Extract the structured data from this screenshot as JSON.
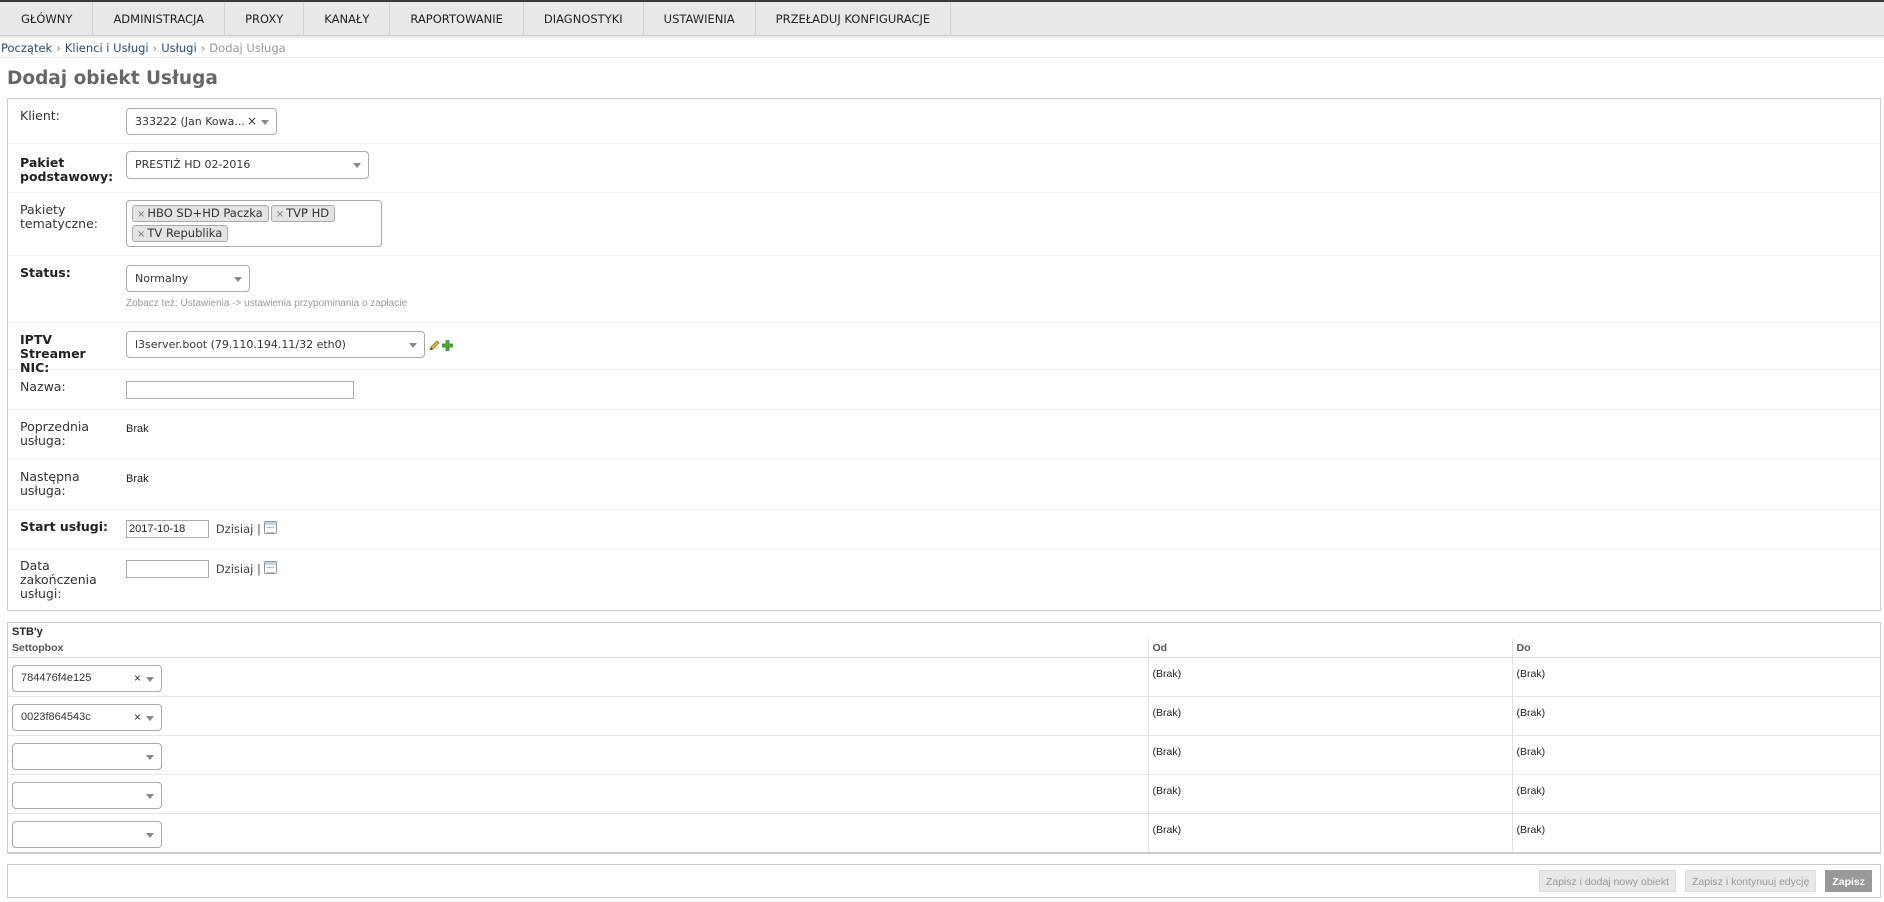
{
  "nav": [
    "GŁÓWNY",
    "ADMINISTRACJA",
    "PROXY",
    "KANAŁY",
    "RAPORTOWANIE",
    "DIAGNOSTYKI",
    "USTAWIENIA",
    "PRZEŁADUJ KONFIGURACJE"
  ],
  "breadcrumbs": {
    "home": "Początek",
    "app": "Klienci i Usługi",
    "model": "Usługi",
    "current": "Dodaj Usługa"
  },
  "page_title": "Dodaj obiekt Usługa",
  "form": {
    "klient": {
      "label": "Klient:",
      "value": "333222 (Jan Kowa..."
    },
    "pakiet": {
      "label": "Pakiet podstawowy:",
      "value": "PRESTIŻ HD 02-2016"
    },
    "tematyczne": {
      "label": "Pakiety tematyczne:",
      "tags": [
        "HBO SD+HD Paczka",
        "TVP HD",
        "TV Republika"
      ]
    },
    "status": {
      "label": "Status:",
      "value": "Normalny",
      "help": "Zobacz też: Ustawienia -> ustawienia przypominania o zapłacie"
    },
    "iptv": {
      "label": "IPTV Streamer NIC:",
      "value": "l3server.boot (79.110.194.11/32 eth0)"
    },
    "nazwa": {
      "label": "Nazwa:",
      "value": ""
    },
    "poprzednia": {
      "label": "Poprzednia usługa:",
      "value": "Brak"
    },
    "nastepna": {
      "label": "Następna usługa:",
      "value": "Brak"
    },
    "start": {
      "label": "Start usługi:",
      "value": "2017-10-18",
      "today": "Dzisiaj |"
    },
    "koniec": {
      "label": "Data zakończenia usługi:",
      "value": "",
      "today": "Dzisiaj |"
    }
  },
  "stb": {
    "title": "STB'y",
    "headers": [
      "Settopbox",
      "Od",
      "Do"
    ],
    "rows": [
      {
        "settopbox": "784476f4e125",
        "od": "(Brak)",
        "do": "(Brak)"
      },
      {
        "settopbox": "0023f864543c",
        "od": "(Brak)",
        "do": "(Brak)"
      },
      {
        "settopbox": "",
        "od": "(Brak)",
        "do": "(Brak)"
      },
      {
        "settopbox": "",
        "od": "(Brak)",
        "do": "(Brak)"
      },
      {
        "settopbox": "",
        "od": "(Brak)",
        "do": "(Brak)"
      }
    ]
  },
  "buttons": {
    "save_add": "Zapisz i dodaj nowy obiekt",
    "save_continue": "Zapisz i kontynuuj edycję",
    "save": "Zapisz"
  },
  "icons": {
    "edit": "pencil-icon",
    "add": "plus-icon",
    "calendar": "calendar-icon",
    "clear": "clear-icon",
    "dropdown": "chevron-down-icon"
  },
  "colors": {
    "nav_bg": "#e8e8e8",
    "link": "#2b4a6b",
    "title": "#666666",
    "button_primary": "#999999",
    "add_icon": "#3c9a2f"
  }
}
